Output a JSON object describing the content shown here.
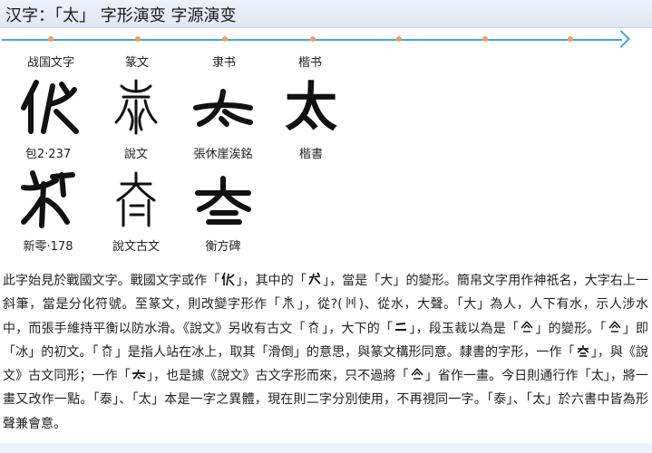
{
  "header": {
    "title": "汉字：「太」 字形演变 字源演变"
  },
  "timeline": {
    "dot_count": 7,
    "color": "#3aa9d9",
    "dot_color": "#f0a05a"
  },
  "era_labels": [
    "战国文字",
    "篆文",
    "隶书",
    "楷书"
  ],
  "row1": [
    {
      "caption": "包2·237",
      "icon": "bronze-tai-glyph"
    },
    {
      "caption": "說文",
      "icon": "seal-tai-glyph"
    },
    {
      "caption": "張休崖涘銘",
      "icon": "clerical-tai-glyph"
    },
    {
      "caption": "楷書",
      "char": "太"
    }
  ],
  "row2": [
    {
      "caption": "新零·178",
      "icon": "bamboo-tai-glyph"
    },
    {
      "caption": "說文古文",
      "icon": "ancient-tai-glyph"
    },
    {
      "caption": "衡方碑",
      "icon": "stele-tai-glyph"
    }
  ],
  "paragraph": {
    "s1": "此字始見於戰國文字。戰國文字或作「",
    "s2": "」，其中的「",
    "s3": "」，當是「大」的變形。簡帛文字用作神祇名，大字右上一斜筆，當是分化符號。至篆文，則改變字形作「",
    "s4": "」，從",
    "s5": "(",
    "s6": ")、從水，大聲。「大」為人，人下有水，示人涉水中，而張手維持平衡以防水滑。《說文》另收有古文「",
    "s7": "」，大下的「",
    "s8": "」，段玉裁以為是「",
    "s9": "」的變形。「",
    "s10": "」即「冰」的初文。「",
    "s11": "」是指人站在冰上，取其「滑倒」的意思，與篆文構形同意。隸書的字形，一作「",
    "s12": "」，與《說文》古文同形；一作「",
    "s13": "」，也是據《說文》古文字形而來，只不過將「",
    "s14": "」省作一畫。今日則通行作「太」，將一畫又改作一點。「泰」、「太」本是一字之異體，現在則二字分別使用，不再視同一字。「泰」、「太」於六書中皆為形聲兼會意。",
    "q": "?"
  }
}
